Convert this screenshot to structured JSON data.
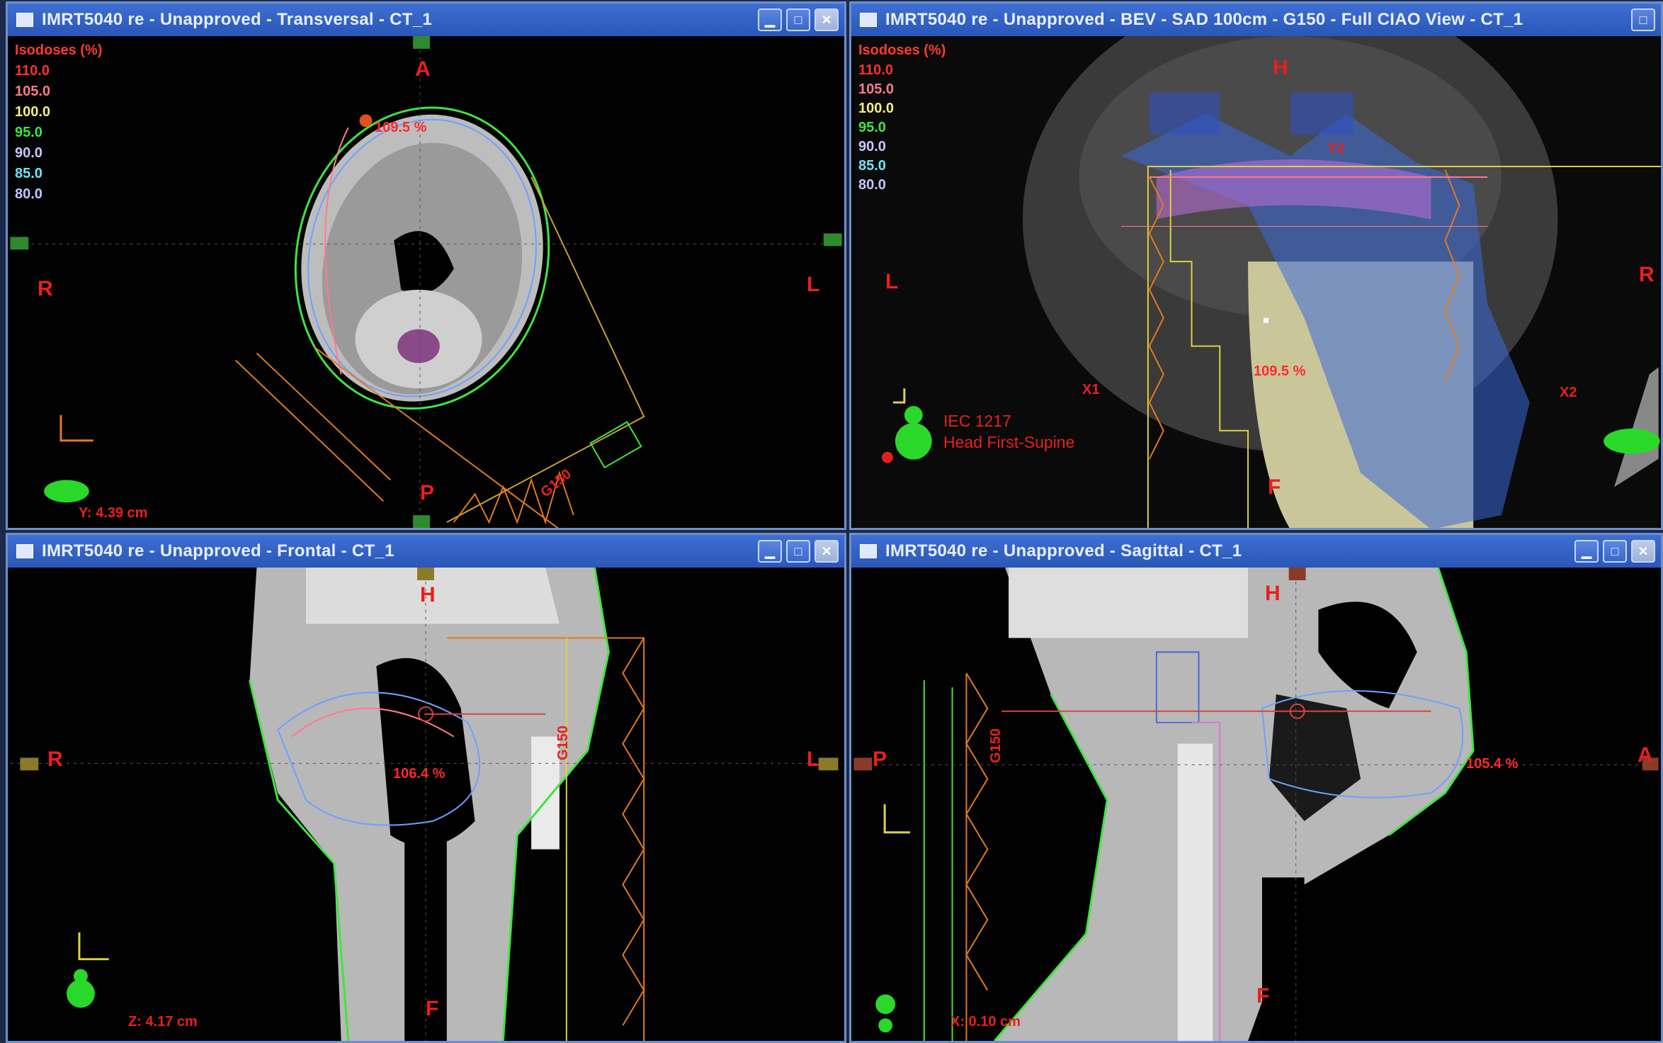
{
  "windows": {
    "transversal": {
      "title": "IMRT5040 re  -  Unapproved - Transversal - CT_1",
      "orient": {
        "top": "A",
        "bottom": "P",
        "left": "R",
        "right": "L"
      },
      "coord": "Y: 4.39 cm",
      "dose_point": "109.5 %",
      "beam_label": "G150"
    },
    "bev": {
      "title": "IMRT5040 re  -  Unapproved  -  BEV  -  SAD 100cm  -  G150  -  Full CIAO View - CT_1",
      "orient": {
        "top": "H",
        "bottom": "F",
        "left": "L",
        "right": "R"
      },
      "jaws": {
        "x1": "X1",
        "x2": "X2",
        "y2": "Y2"
      },
      "dose_point": "109.5 %",
      "info_line1": "IEC 1217",
      "info_line2": "Head First-Supine"
    },
    "frontal": {
      "title": "IMRT5040 re  -  Unapproved - Frontal - CT_1",
      "orient": {
        "top": "H",
        "bottom": "F",
        "left": "R",
        "right": "L"
      },
      "coord": "Z: 4.17 cm",
      "dose_point": "106.4 %",
      "beam_label": "G150"
    },
    "sagittal": {
      "title": "IMRT5040 re  -  Unapproved - Sagittal - CT_1",
      "orient": {
        "top": "H",
        "bottom": "F",
        "left": "P",
        "right": "A"
      },
      "coord": "X: 0.10 cm",
      "dose_point": "105.4 %",
      "beam_label": "G150"
    }
  },
  "isodoses": {
    "header": "Isodoses (%)",
    "levels": [
      {
        "value": "110.0",
        "color": "#ff3030"
      },
      {
        "value": "105.0",
        "color": "#ff7a8a"
      },
      {
        "value": "100.0",
        "color": "#f2f07a"
      },
      {
        "value": "95.0",
        "color": "#3ee63e"
      },
      {
        "value": "90.0",
        "color": "#c8c8ff"
      },
      {
        "value": "85.0",
        "color": "#6ee4ff"
      },
      {
        "value": "80.0",
        "color": "#c0c8ff"
      }
    ]
  }
}
